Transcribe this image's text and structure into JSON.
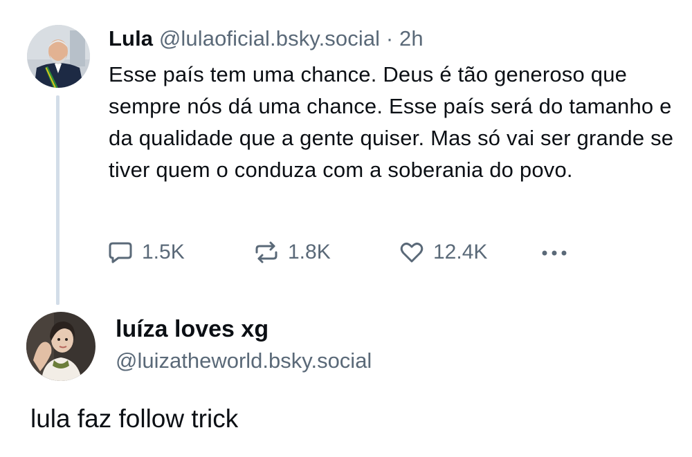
{
  "post": {
    "author_name": "Lula",
    "author_handle": "@lulaoficial.bsky.social",
    "separator": "·",
    "time": "2h",
    "text": "Esse país tem uma chance. Deus é tão generoso que sempre nós dá uma chance. Esse país será do tamanho e da qualidade que a gente quiser. Mas só vai ser grande se tiver quem o conduza com a soberania do povo.",
    "avatar_icon": "profile-photo",
    "actions": {
      "reply": {
        "icon": "speech-bubble-icon",
        "count": "1.5K"
      },
      "repost": {
        "icon": "repost-arrows-icon",
        "count": "1.8K"
      },
      "like": {
        "icon": "heart-icon",
        "count": "12.4K"
      },
      "more": {
        "icon": "more-dots-icon"
      }
    }
  },
  "reply": {
    "author_name": "luíza loves xg",
    "author_handle": "@luizatheworld.bsky.social",
    "text": "lula faz follow trick",
    "avatar_icon": "profile-photo"
  },
  "colors": {
    "text": "#0b0f14",
    "muted": "#5a6978",
    "thread_line": "#d3dde8"
  }
}
